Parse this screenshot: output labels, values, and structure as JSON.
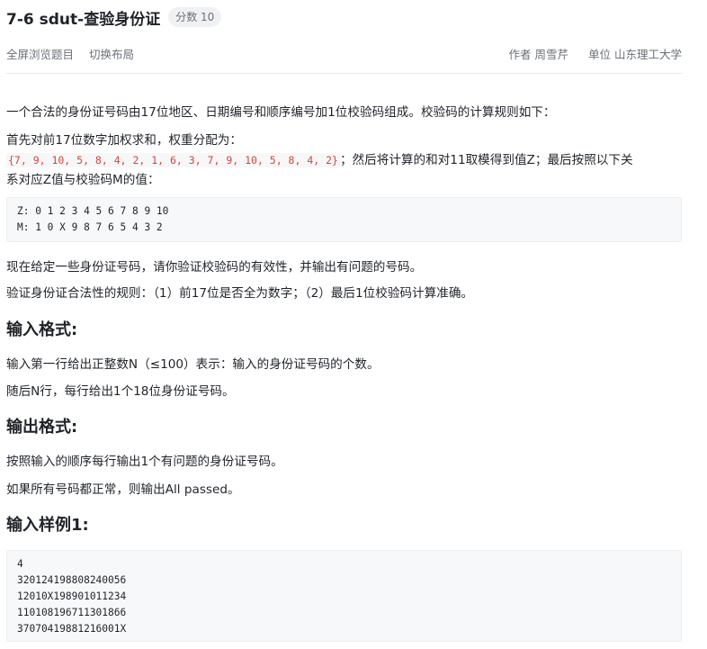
{
  "header": {
    "title": "7-6 sdut-查验身份证",
    "score_badge": "分数 10"
  },
  "meta": {
    "fullscreen_label": "全屏浏览题目",
    "switch_layout_label": "切换布局",
    "author_key": "作者",
    "author_value": "周雪芹",
    "unit_key": "单位",
    "unit_value": "山东理工大学"
  },
  "description": {
    "p1": "一个合法的身份证号码由17位地区、日期编号和顺序编号加1位校验码组成。校验码的计算规则如下：",
    "p2": "首先对前17位数字加权求和，权重分配为：",
    "weights_code": "{7, 9, 10, 5, 8, 4, 2, 1, 6, 3, 7, 9, 10, 5, 8, 4, 2}",
    "p3_after_code": "；然后将计算的和对11取模得到值Z；最后按照以下关",
    "p4": "系对应Z值与校验码M的值：",
    "mapping_code": "Z: 0 1 2 3 4 5 6 7 8 9 10\nM: 1 0 X 9 8 7 6 5 4 3 2",
    "p5": "现在给定一些身份证号码，请你验证校验码的有效性，并输出有问题的号码。",
    "p6": "验证身份证合法性的规则：（1）前17位是否全为数字；（2）最后1位校验码计算准确。"
  },
  "input_format": {
    "heading": "输入格式:",
    "p1": "输入第一行给出正整数N（≤100）表示：输入的身份证号码的个数。",
    "p2": "随后N行，每行给出1个18位身份证号码。"
  },
  "output_format": {
    "heading": "输出格式:",
    "p1": "按照输入的顺序每行输出1个有问题的身份证号码。",
    "p2": "如果所有号码都正常，则输出All passed。"
  },
  "sample_input": {
    "heading": "输入样例1:",
    "code": "4\n320124198808240056\n12010X198901011234\n110108196711301866\n37070419881216001X"
  }
}
